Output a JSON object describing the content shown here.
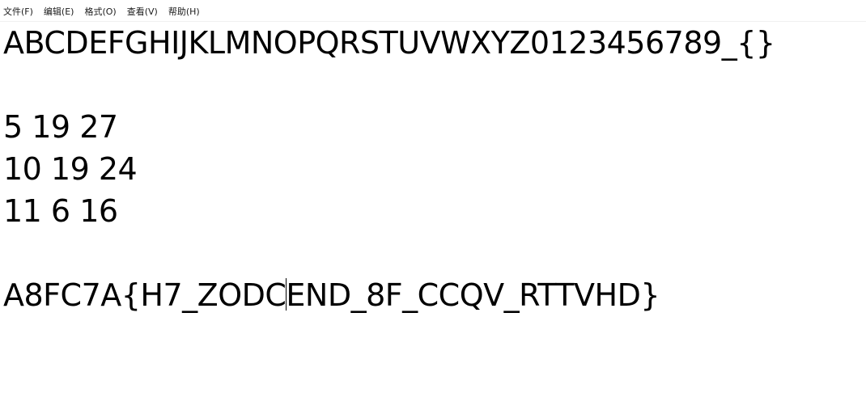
{
  "menu": {
    "items": [
      {
        "label": "文件(F)"
      },
      {
        "label": "编辑(E)"
      },
      {
        "label": "格式(O)"
      },
      {
        "label": "查看(V)"
      },
      {
        "label": "帮助(H)"
      }
    ]
  },
  "document": {
    "line1": "ABCDEFGHIJKLMNOPQRSTUVWXYZ0123456789_{}",
    "line2": "",
    "line3": "5 19 27",
    "line4": "10 19 24",
    "line5": "11 6 16",
    "line6": "",
    "line7_before_caret": "A8FC7A{H7_ZODC",
    "line7_after_caret": "END_8F_CCQV_RTTVHD}"
  }
}
